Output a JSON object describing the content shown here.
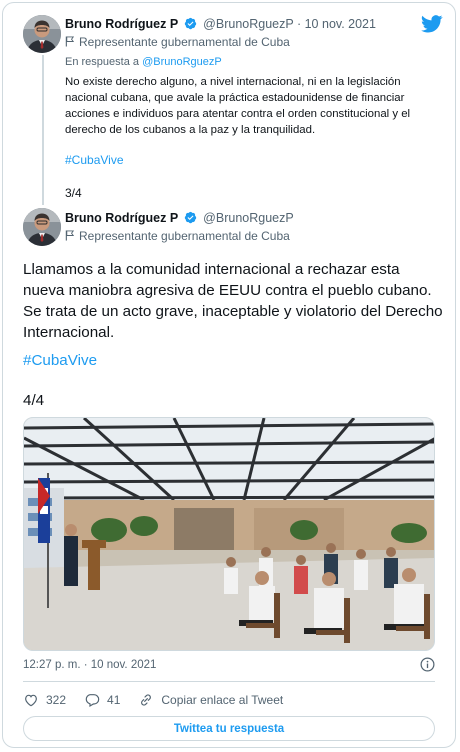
{
  "brand": {
    "accent": "#1d9bf0",
    "text": "#0f1419",
    "muted": "#536471",
    "border": "#cfd9de"
  },
  "tweet1": {
    "name": "Bruno Rodríguez P",
    "handle": "@BrunoRguezP",
    "separator": "·",
    "date": "10 nov. 2021",
    "label": "Representante gubernamental de Cuba",
    "reply_prefix": "En respuesta a",
    "reply_handle": "@BrunoRguezP",
    "text": "No existe derecho alguno, a nivel internacional, ni en la legislación nacional cubana, que avale la práctica estadounidense de financiar acciones e individuos para atentar contra el orden constitucional y el derecho de los cubanos a la paz y la tranquilidad.",
    "hashtag": "#CubaVive",
    "count": "3/4"
  },
  "tweet2": {
    "name": "Bruno Rodríguez P",
    "handle": "@BrunoRguezP",
    "label": "Representante gubernamental de Cuba",
    "text": "Llamamos a la comunidad internacional a rechazar esta nueva maniobra agresiva de EEUU contra el pueblo cubano. Se trata de un acto grave, inaceptable y violatorio del Derecho Internacional.",
    "hashtag": "#CubaVive",
    "count": "4/4",
    "timestamp": "12:27 p. m. · 10 nov. 2021",
    "likes": "322",
    "replies": "41",
    "copy_link": "Copiar enlace al Tweet",
    "reply_button": "Twittea tu respuesta"
  },
  "icons": [
    "twitter-bird-icon",
    "verified-badge-icon",
    "government-flag-icon",
    "info-icon",
    "heart-icon",
    "reply-bubble-icon",
    "link-icon"
  ]
}
